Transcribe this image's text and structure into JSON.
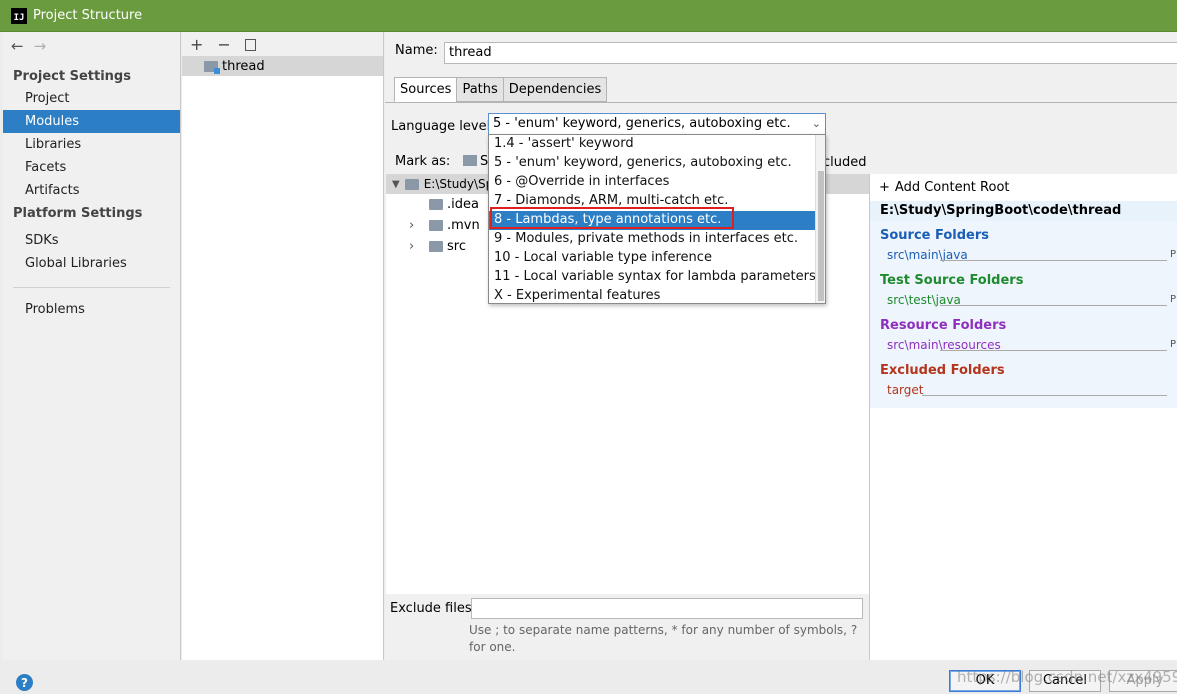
{
  "window": {
    "title": "Project Structure",
    "app_icon": "intellij-icon"
  },
  "nav": {
    "back_icon": "arrow-left-icon",
    "forward_icon": "arrow-right-icon",
    "project_settings_header": "Project Settings",
    "project_settings": [
      "Project",
      "Modules",
      "Libraries",
      "Facets",
      "Artifacts"
    ],
    "selected": "Modules",
    "platform_settings_header": "Platform Settings",
    "platform_settings": [
      "SDKs",
      "Global Libraries"
    ],
    "problems": "Problems"
  },
  "modules": {
    "toolbar": {
      "add": "+",
      "remove": "−",
      "copy_icon": "copy-icon"
    },
    "items": [
      "thread"
    ]
  },
  "module": {
    "name_label": "Name:",
    "name_value": "thread",
    "tabs": [
      "Sources",
      "Paths",
      "Dependencies"
    ],
    "active_tab": "Sources",
    "language_level_label": "Language level:",
    "language_level_value": "5 - 'enum' keyword, generics, autoboxing etc.",
    "mark_as_label": "Mark as:",
    "mark_as_partial": "S",
    "mark_as_excluded_partial": "cluded",
    "tree": {
      "root": "E:\\Study\\Sp",
      "children": [
        ".idea",
        ".mvn",
        "src"
      ]
    },
    "content_root": {
      "add_label": "Add Content Root",
      "path": "E:\\Study\\SpringBoot\\code\\thread",
      "source_folders_title": "Source Folders",
      "source_folders": [
        "src\\main\\java"
      ],
      "test_source_folders_title": "Test Source Folders",
      "test_source_folders": [
        "src\\test\\java"
      ],
      "resource_folders_title": "Resource Folders",
      "resource_folders": [
        "src\\main\\resources"
      ],
      "excluded_folders_title": "Excluded Folders",
      "excluded_folders": [
        "target"
      ],
      "props_marker": "P"
    },
    "exclude_files_label": "Exclude files:",
    "exclude_files_value": "",
    "exclude_hint": "Use ; to separate name patterns, * for any number of symbols, ? for one."
  },
  "language_dropdown": {
    "options": [
      "1.4 - 'assert' keyword",
      "5 - 'enum' keyword, generics, autoboxing etc.",
      "6 - @Override in interfaces",
      "7 - Diamonds, ARM, multi-catch etc.",
      "8 - Lambdas, type annotations etc.",
      "9 - Modules, private methods in interfaces etc.",
      "10 - Local variable type inference",
      "11 - Local variable syntax for lambda parameters",
      "X - Experimental features"
    ],
    "highlighted_index": 4
  },
  "footer": {
    "help": "?",
    "ok": "OK",
    "cancel": "Cancel",
    "apply": "Apply",
    "watermark": "https://blog.csdn.net/xzx4959"
  },
  "colors": {
    "titlebar": "#6b9b3f",
    "selection": "#2d7fc5",
    "source": "#1b5eb5",
    "test": "#1f8a2e",
    "resource": "#8f2fc0",
    "excluded": "#b3361c",
    "highlight_box": "#e02020"
  }
}
